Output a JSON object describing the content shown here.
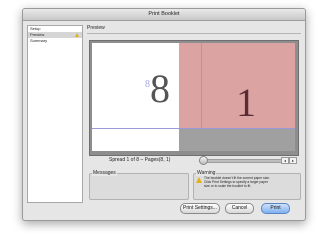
{
  "window": {
    "title": "Print Booklet"
  },
  "sidebar": {
    "items": [
      {
        "label": "Setup",
        "selected": false,
        "warning": false
      },
      {
        "label": "Preview",
        "selected": true,
        "warning": true
      },
      {
        "label": "Summary",
        "selected": false,
        "warning": false
      }
    ]
  },
  "preview": {
    "title": "Preview",
    "left_page_number": "8",
    "left_page_small_number": "8",
    "right_page_number": "1",
    "spread_label": "Spread 1 of 8 – Pages(8, 1)",
    "slider_position_fraction": 0
  },
  "messages": {
    "label": "Messages"
  },
  "warning": {
    "label": "Warning",
    "text": "The booklet doesn't fit the current paper size. Click Print Settings to specify a larger paper size or to scale the booklet to fit."
  },
  "buttons": {
    "print_settings": "Print Settings...",
    "cancel": "Cancel",
    "print": "Print"
  },
  "colors": {
    "right_page": "#dca3a3",
    "guide": "#9a9ad8",
    "warning_icon": "#e0b11a"
  }
}
